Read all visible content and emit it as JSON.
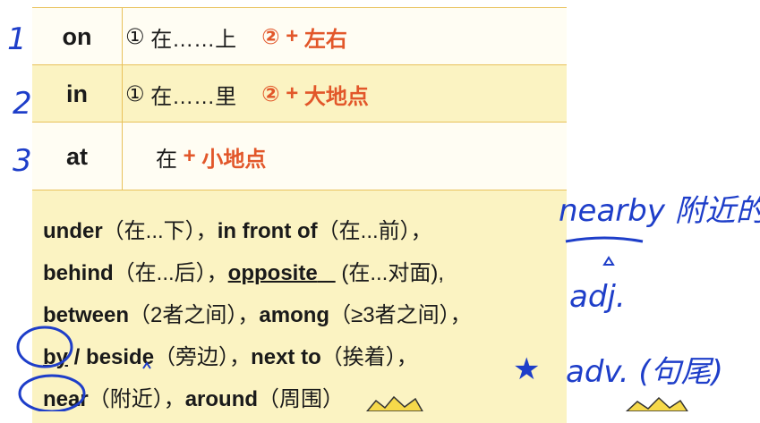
{
  "rows": [
    {
      "word": "on",
      "num1": "①",
      "meaning": "在……上",
      "num2": "②",
      "plus": "+",
      "extra": "左右"
    },
    {
      "word": "in",
      "num1": "①",
      "meaning": "在……里",
      "num2": "②",
      "plus": "+",
      "extra": "大地点"
    },
    {
      "word": "at",
      "meaning": "在",
      "plus": "+",
      "extra": "小地点"
    }
  ],
  "prep_lines": {
    "l1": {
      "a": "under",
      "a_cn": "（在...下），",
      "b": "in front of",
      "b_cn": "（在...前），"
    },
    "l2": {
      "a": "behind",
      "a_cn": "（在...后），",
      "b": "opposite",
      "b_space": "   ",
      "b_cn": "(在...对面),"
    },
    "l3": {
      "a": "between",
      "a_cn": "（2者之间），",
      "b": "among",
      "b_cn": "（≥3者之间），"
    },
    "l4": {
      "a": "by",
      "a_sep": " / ",
      "b": "beside",
      "b_cn": "（旁边），",
      "c": "next to",
      "c_cn": "（挨着），"
    },
    "l5": {
      "a": "near",
      "a_cn": "（附近），",
      "b": "around",
      "b_cn": "（周围）"
    }
  },
  "handwriting": {
    "num1": "1",
    "num2": "2",
    "num3": "3",
    "note1": "nearby 附近的",
    "note2": "adj.",
    "star": "★",
    "note3": "adv. (句尾)"
  },
  "colors": {
    "border": "#e8c15a",
    "row_light": "#fffdf3",
    "row_dark": "#fbf3c2",
    "accent": "#e2572a",
    "ink": "#1e3ec9"
  }
}
